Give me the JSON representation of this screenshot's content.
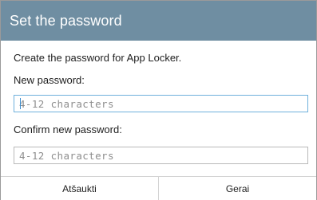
{
  "dialog": {
    "title": "Set the password",
    "description": "Create the password for App Locker.",
    "new_password_label": "New password:",
    "new_password_placeholder": "4-12 characters",
    "confirm_password_label": "Confirm new password:",
    "confirm_password_placeholder": "4-12 characters"
  },
  "buttons": {
    "cancel_label": "Atšaukti",
    "ok_label": "Gerai"
  },
  "colors": {
    "header_bg": "#6f8ea2",
    "focus_border": "#6fb1dc"
  }
}
